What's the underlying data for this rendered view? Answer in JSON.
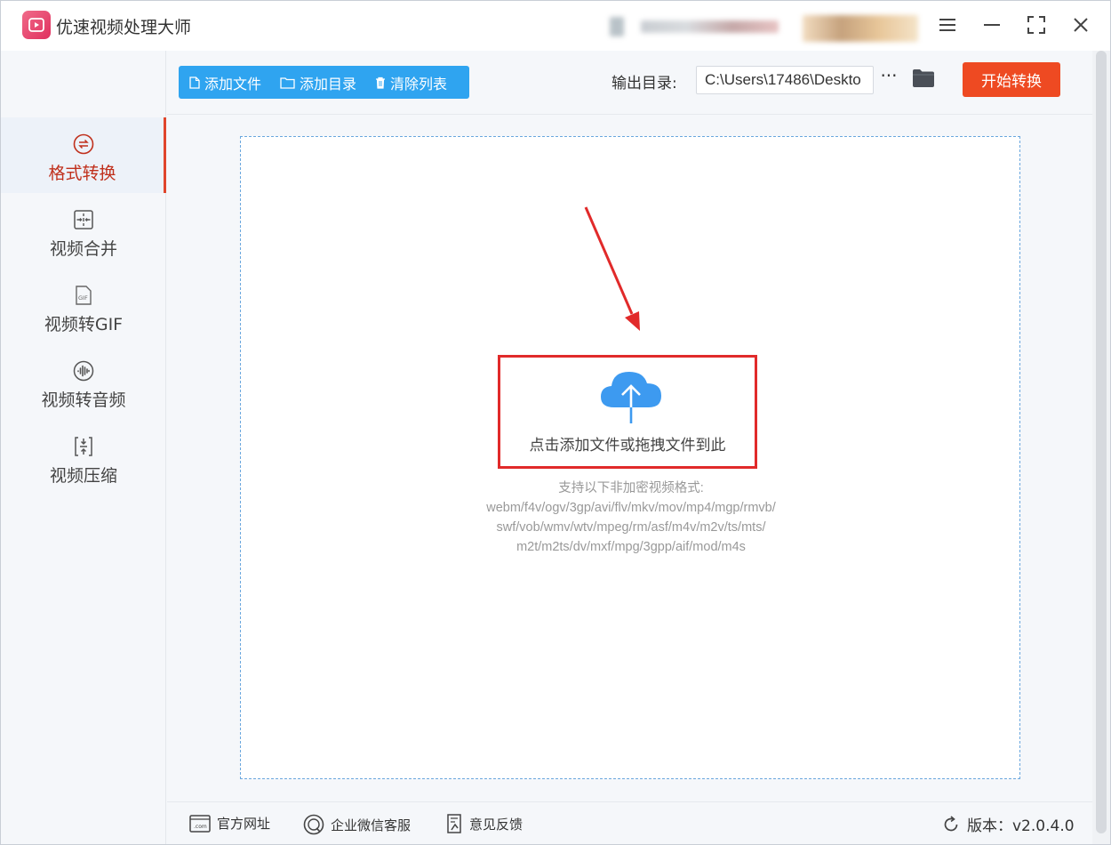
{
  "app": {
    "title": "优速视频处理大师"
  },
  "sidebar": {
    "items": [
      {
        "label": "格式转换",
        "icon": "swap-icon",
        "active": true
      },
      {
        "label": "视频合并",
        "icon": "merge-icon",
        "active": false
      },
      {
        "label": "视频转GIF",
        "icon": "gif-icon",
        "active": false
      },
      {
        "label": "视频转音频",
        "icon": "audio-wave-icon",
        "active": false
      },
      {
        "label": "视频压缩",
        "icon": "compress-icon",
        "active": false
      }
    ]
  },
  "toolbar": {
    "add_file": "添加文件",
    "add_folder": "添加目录",
    "clear_list": "清除列表",
    "output_label": "输出目录:",
    "output_path": "C:\\Users\\17486\\Deskto",
    "more_label": "···",
    "start_label": "开始转换"
  },
  "dropzone": {
    "upload_text": "点击添加文件或拖拽文件到此",
    "formats_title": "支持以下非加密视频格式:",
    "formats_lines": [
      "webm/f4v/ogv/3gp/avi/flv/mkv/mov/mp4/mgp/rmvb/",
      "swf/vob/wmv/wtv/mpeg/rm/asf/m4v/m2v/ts/mts/",
      "m2t/m2ts/dv/mxf/mpg/3gpp/aif/mod/m4s"
    ]
  },
  "footer": {
    "website": "官方网址",
    "wechat": "企业微信客服",
    "feedback": "意见反馈",
    "version": "版本：v2.0.4.0"
  },
  "colors": {
    "accent_blue": "#2fa4f0",
    "start_orange": "#ee4a22",
    "highlight_red": "#e12a2a",
    "active_text": "#c0301c"
  }
}
